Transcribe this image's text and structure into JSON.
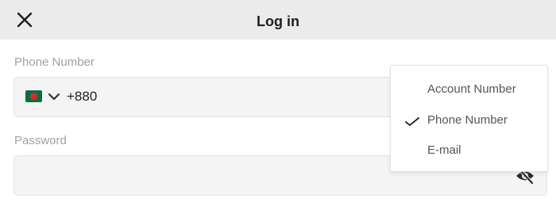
{
  "header": {
    "title": "Log in",
    "close_icon": "close-icon"
  },
  "form": {
    "phone_label": "Phone Number",
    "country_flag": "bangladesh-flag-icon",
    "dial_code": "+880",
    "phone_value": "",
    "password_label": "Password",
    "password_value": "",
    "password_visibility_icon": "eye-slash-icon"
  },
  "login_type_menu": {
    "items": [
      {
        "label": "Account Number",
        "selected": false
      },
      {
        "label": "Phone Number",
        "selected": true
      },
      {
        "label": "E-mail",
        "selected": false
      }
    ]
  },
  "colors": {
    "header_bg": "#ebebeb",
    "input_bg": "#f4f4f4",
    "label_gray": "#a0a0a0",
    "flag_green": "#0a6e44",
    "flag_red": "#e0262a"
  }
}
